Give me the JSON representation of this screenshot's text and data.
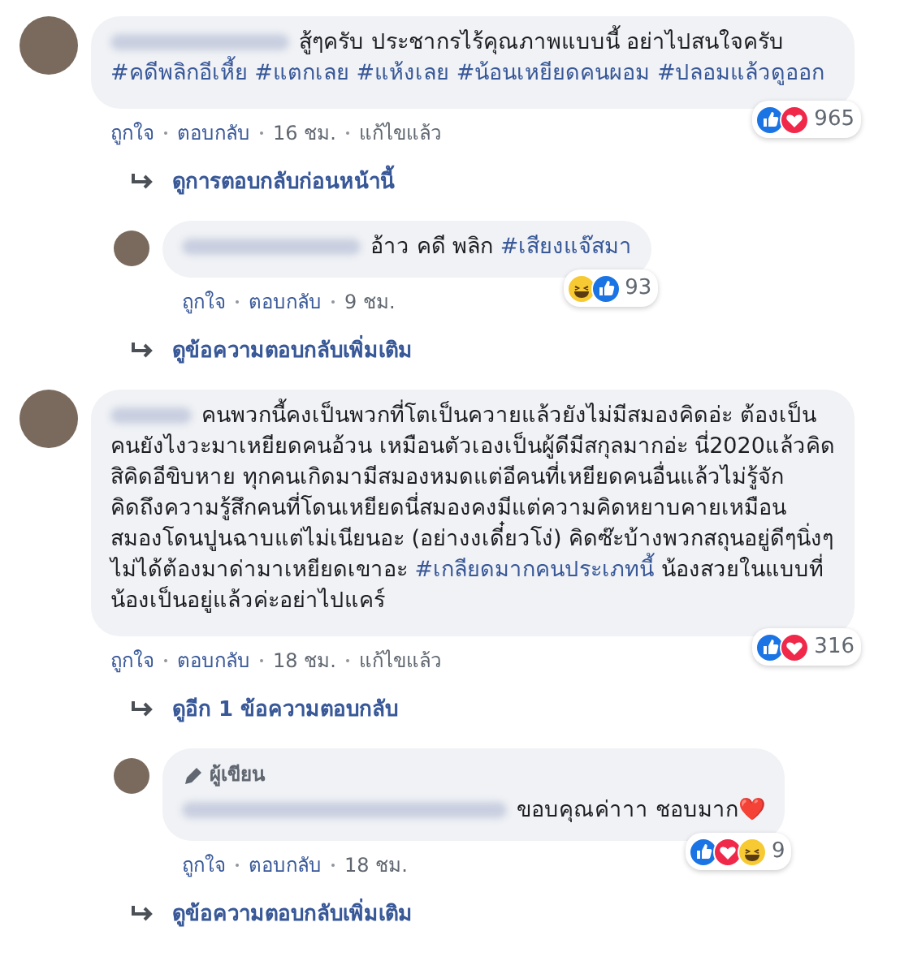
{
  "comments": [
    {
      "kind": "top",
      "author": {
        "kind": "blurred"
      },
      "parts": [
        {
          "kind": "text",
          "text": "สู้ๆครับ ประชากรไร้คุณภาพแบบนี้ อย่าไปสนใจครับ"
        },
        {
          "kind": "hashtag",
          "text": "#คดีพลิกอีเหี้ย"
        },
        {
          "kind": "hashtag",
          "text": "#แตกเลย"
        },
        {
          "kind": "hashtag",
          "text": "#แห้งเลย"
        },
        {
          "kind": "hashtag",
          "text": "#น้อนเหยียดคนผอม"
        },
        {
          "kind": "hashtag",
          "text": "#ปลอมแล้วดูออก"
        }
      ],
      "reactions": {
        "icons": [
          {
            "kind": "like"
          },
          {
            "kind": "love"
          }
        ],
        "count": "965"
      },
      "actions": [
        "ถูกใจ",
        "ตอบกลับ"
      ],
      "time": "16 ชม.",
      "edited": "แก้ไขแล้ว"
    },
    {
      "kind": "link",
      "text": "ดูการตอบกลับก่อนหน้านี้"
    },
    {
      "kind": "reply",
      "author": {
        "kind": "blurred"
      },
      "parts": [
        {
          "kind": "text",
          "text": "อ้าว คดี พลิก"
        },
        {
          "kind": "hashtag",
          "text": "#เสียงแจ๊สมา"
        }
      ],
      "reactions": {
        "icons": [
          {
            "kind": "haha"
          },
          {
            "kind": "like"
          }
        ],
        "count": "93"
      },
      "actions": [
        "ถูกใจ",
        "ตอบกลับ"
      ],
      "time": "9 ชม."
    },
    {
      "kind": "link",
      "text": "ดูข้อความตอบกลับเพิ่มเติม"
    },
    {
      "kind": "top",
      "author": {
        "kind": "blurred_short"
      },
      "parts": [
        {
          "kind": "text",
          "text": "คนพวกนี้คงเป็นพวกที่โตเป็นควายแล้วยังไม่มีสมองคิดอ่ะ ต้องเป็นคนยังไงวะมาเหยียดคนอ้วน เหมือนตัวเองเป็นผู้ดีมีสกุลมากอ่ะ นี่2020แล้วคิดสิคิดอีขิบหาย ทุกคนเกิดมามีสมองหมดแต่อีคนที่เหยียดคนอื่นแล้วไม่รู้จักคิดถึงความรู้สึกคนที่โดนเหยียดนี่สมองคงมีแต่ความคิดหยาบคายเหมือนสมองโดนปูนฉาบแต่ไม่เนียนอะ (อย่างงเดี๋ยวโง่) คิดซ๊ะบ้างพวกสถุนอยู่ดีๆนิ่งๆไม่ได้ต้องมาด่ามาเหยียดเขาอะ"
        },
        {
          "kind": "hashtag",
          "text": "#เกลียดมากคนประเภทนี้"
        },
        {
          "kind": "text",
          "text": "น้องสวยในแบบที่น้องเป็นอยู่แล้วค่ะอย่าไปแคร์"
        }
      ],
      "reactions": {
        "icons": [
          {
            "kind": "like"
          },
          {
            "kind": "love"
          }
        ],
        "count": "316"
      },
      "actions": [
        "ถูกใจ",
        "ตอบกลับ"
      ],
      "time": "18 ชม.",
      "edited": "แก้ไขแล้ว"
    },
    {
      "kind": "link",
      "text": "ดูอีก 1 ข้อความตอบกลับ"
    },
    {
      "kind": "reply",
      "badge": "ผู้เขียน",
      "author": {
        "kind": "blurred_long"
      },
      "parts": [
        {
          "kind": "text",
          "text": "ขอบคุณค่าาา ชอบมาก❤️"
        }
      ],
      "reactions": {
        "icons": [
          {
            "kind": "like"
          },
          {
            "kind": "love"
          },
          {
            "kind": "haha"
          }
        ],
        "count": "9"
      },
      "actions": [
        "ถูกใจ",
        "ตอบกลับ"
      ],
      "time": "18 ชม."
    },
    {
      "kind": "link",
      "text": "ดูข้อความตอบกลับเพิ่มเติม"
    }
  ]
}
